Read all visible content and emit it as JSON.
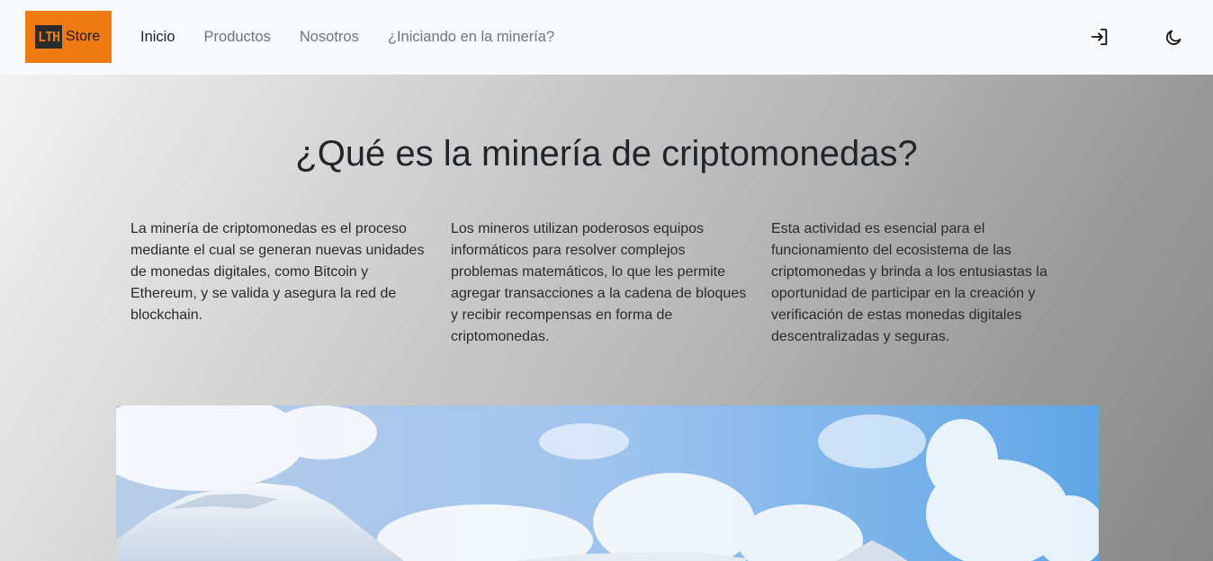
{
  "navbar": {
    "logo": {
      "mark": "LTH",
      "text": "Store"
    },
    "links": [
      {
        "label": "Inicio",
        "active": true
      },
      {
        "label": "Productos",
        "active": false
      },
      {
        "label": "Nosotros",
        "active": false
      },
      {
        "label": "¿Iniciando en la minería?",
        "active": false
      }
    ],
    "icons": [
      "login-icon",
      "moon-icon"
    ]
  },
  "hero": {
    "title": "¿Qué es la minería de criptomonedas?",
    "columns": [
      "La minería de criptomonedas es el proceso mediante el cual se generan nuevas unidades de monedas digitales, como Bitcoin y Ethereum, y se valida y asegura la red de blockchain.",
      "Los mineros utilizan poderosos equipos informáticos para resolver complejos problemas matemáticos, lo que les permite agregar transacciones a la cadena de bloques y recibir recompensas en forma de criptomonedas.",
      "Esta actividad es esencial para el funcionamiento del ecosistema de las criptomonedas y brinda a los entusiastas la oportunidad de participar en la creación y verificación de estas monedas digitales descentralizadas y seguras."
    ]
  },
  "colors": {
    "brand": "#ee7a14",
    "navbar_bg": "#f8f9fa"
  }
}
